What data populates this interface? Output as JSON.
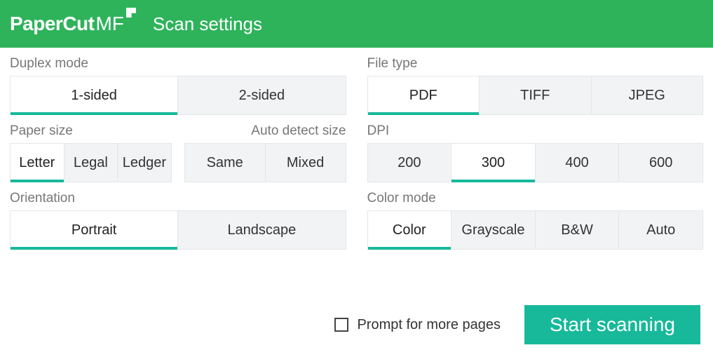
{
  "brand": {
    "paper": "Paper",
    "cut": "Cut",
    "mf": "MF"
  },
  "header": {
    "title": "Scan settings"
  },
  "duplex": {
    "label": "Duplex mode",
    "options": [
      "1-sided",
      "2-sided"
    ],
    "selected": "1-sided"
  },
  "paperSize": {
    "label": "Paper size",
    "sublabel": "Auto detect size",
    "sizes": [
      "Letter",
      "Legal",
      "Ledger"
    ],
    "autos": [
      "Same",
      "Mixed"
    ],
    "selected": "Letter"
  },
  "orientation": {
    "label": "Orientation",
    "options": [
      "Portrait",
      "Landscape"
    ],
    "selected": "Portrait"
  },
  "fileType": {
    "label": "File type",
    "options": [
      "PDF",
      "TIFF",
      "JPEG"
    ],
    "selected": "PDF"
  },
  "dpi": {
    "label": "DPI",
    "options": [
      "200",
      "300",
      "400",
      "600"
    ],
    "selected": "300"
  },
  "colorMode": {
    "label": "Color mode",
    "options": [
      "Color",
      "Grayscale",
      "B&W",
      "Auto"
    ],
    "selected": "Color"
  },
  "footer": {
    "promptLabel": "Prompt for more pages",
    "promptChecked": false,
    "startLabel": "Start scanning"
  },
  "colors": {
    "headerBg": "#2eb35b",
    "accent": "#17b99a"
  }
}
